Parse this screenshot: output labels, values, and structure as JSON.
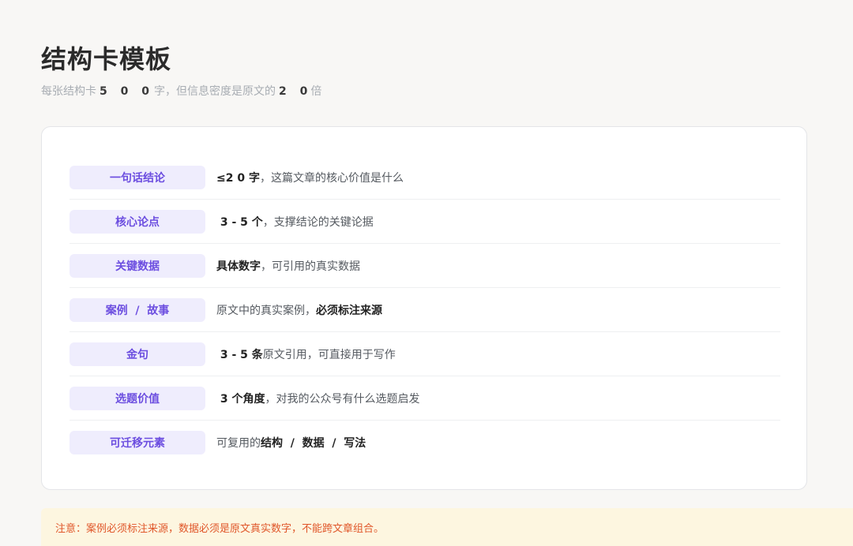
{
  "header": {
    "title": "结构卡模板",
    "subtitle_prefix": "每张结构卡",
    "subtitle_num1": "5 0 0",
    "subtitle_middle": "字，但信息密度是原文的",
    "subtitle_num2": "2 0",
    "subtitle_suffix": "倍"
  },
  "rows": [
    {
      "label": "一句话结论",
      "bold": "≤2 0 字",
      "rest": "，这篇文章的核心价值是什么"
    },
    {
      "label": "核心论点",
      "bold": " 3 - 5 个",
      "rest": "，支撑结论的关键论据"
    },
    {
      "label": "关键数据",
      "bold": "具体数字",
      "rest": "，可引用的真实数据"
    },
    {
      "label": "案例  /  故事",
      "pre": "原文中的真实案例，",
      "bold": "必须标注来源",
      "rest": ""
    },
    {
      "label": "金句",
      "bold": " 3 - 5 条",
      "rest": "原文引用，可直接用于写作"
    },
    {
      "label": "选题价值",
      "bold": " 3 个角度",
      "rest": "，对我的公众号有什么选题启发"
    },
    {
      "label": "可迁移元素",
      "pre": "可复用的",
      "bold": "结构  /  数据  /  写法",
      "rest": ""
    }
  ],
  "note": {
    "text": "注意：案例必须标注来源，数据必须是原文真实数字，不能跨文章组合。"
  }
}
